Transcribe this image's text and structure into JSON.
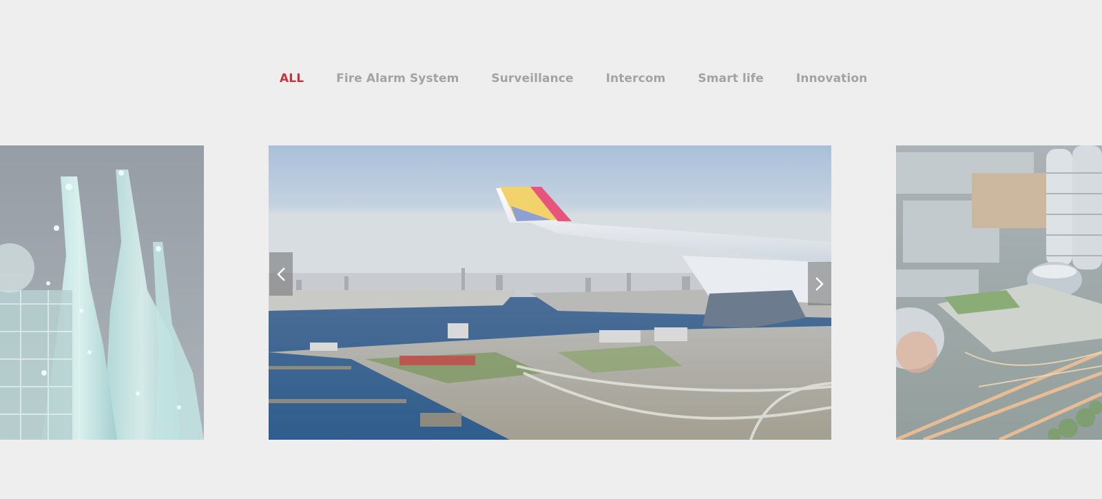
{
  "filter_tabs": {
    "items": [
      {
        "label": "ALL",
        "active": true
      },
      {
        "label": "Fire Alarm System",
        "active": false
      },
      {
        "label": "Surveillance",
        "active": false
      },
      {
        "label": "Intercom",
        "active": false
      },
      {
        "label": "Smart life",
        "active": false
      },
      {
        "label": "Innovation",
        "active": false
      }
    ]
  },
  "carousel": {
    "slides": [
      {
        "position": "previous",
        "subject": "industrial refinery towers at night"
      },
      {
        "position": "current",
        "subject": "aerial view from airplane wing over harbor city"
      },
      {
        "position": "next",
        "subject": "aerial view of city buildings and highways at dusk"
      }
    ],
    "prev_icon": "chevron-left-icon",
    "next_icon": "chevron-right-icon"
  },
  "colors": {
    "background": "#eeeeee",
    "tab_active": "#c8323b",
    "tab_inactive": "#a3a3a3"
  }
}
